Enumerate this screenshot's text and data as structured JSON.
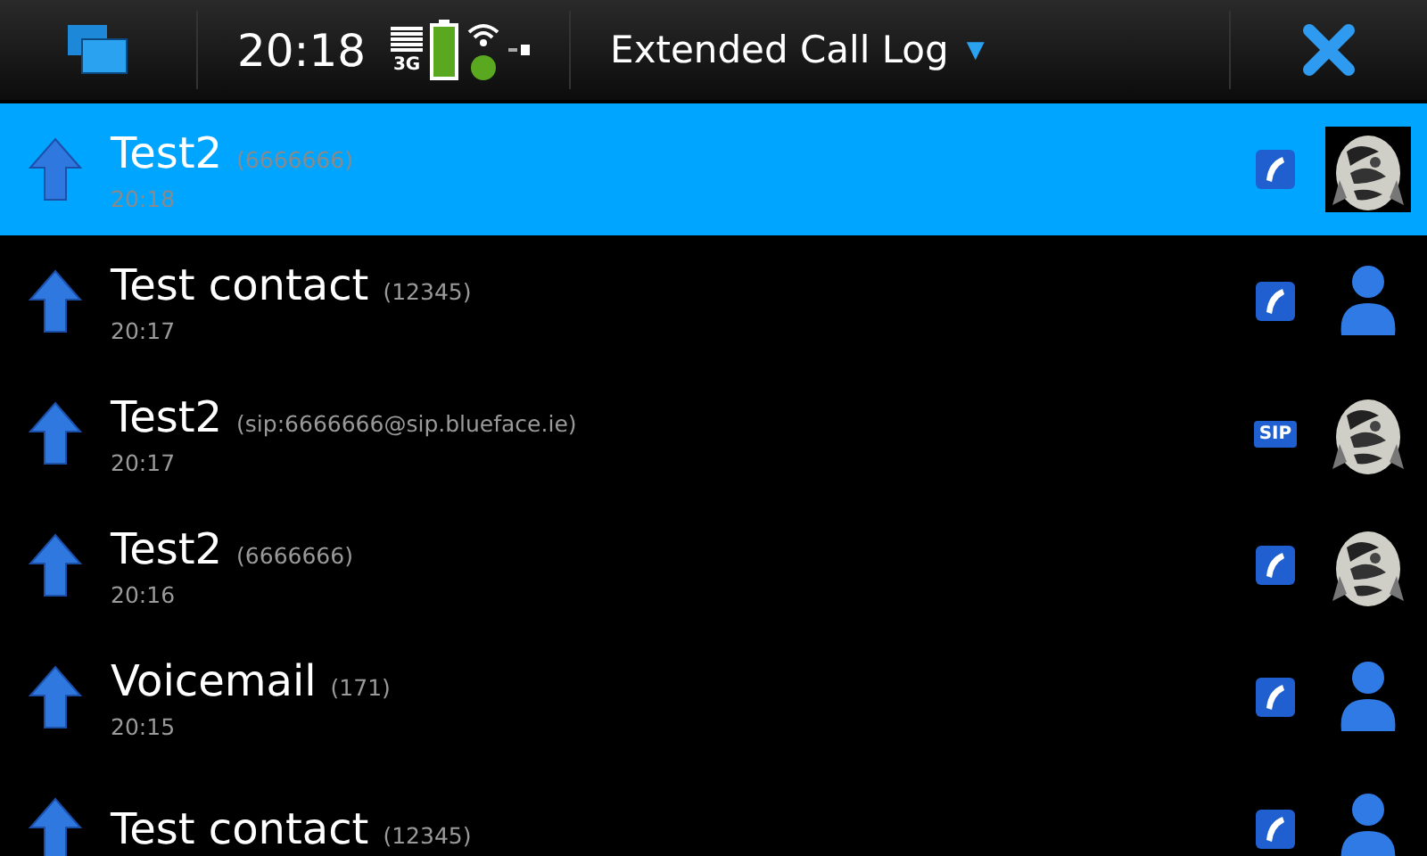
{
  "status_bar": {
    "time": "20:18",
    "network": "3G"
  },
  "title": {
    "text": "Extended Call Log",
    "caret": "▼"
  },
  "calls": [
    {
      "name": "Test2",
      "number": "(6666666)",
      "time": "20:18",
      "kind": "phone",
      "selected": true
    },
    {
      "name": "Test contact",
      "number": "(12345)",
      "time": "20:17",
      "kind": "phone",
      "avatar": {
        "kind": "silhouette"
      },
      "selected": false
    },
    {
      "name": "Test2",
      "number": "(sip:6666666@sip.blueface.ie)",
      "time": "20:17",
      "kind": "sip",
      "badge": "SIP",
      "selected": false
    },
    {
      "name": "Test2",
      "number": "(6666666)",
      "time": "20:16",
      "kind": "phone",
      "selected": false
    },
    {
      "name": "Voicemail",
      "number": "(171)",
      "time": "20:15",
      "kind": "phone",
      "avatar": {
        "kind": "silhouette"
      },
      "selected": false
    },
    {
      "name": "Test contact",
      "number": "(12345)",
      "kind": "phone",
      "avatar": {
        "kind": "silhouette"
      },
      "selected": false
    }
  ]
}
